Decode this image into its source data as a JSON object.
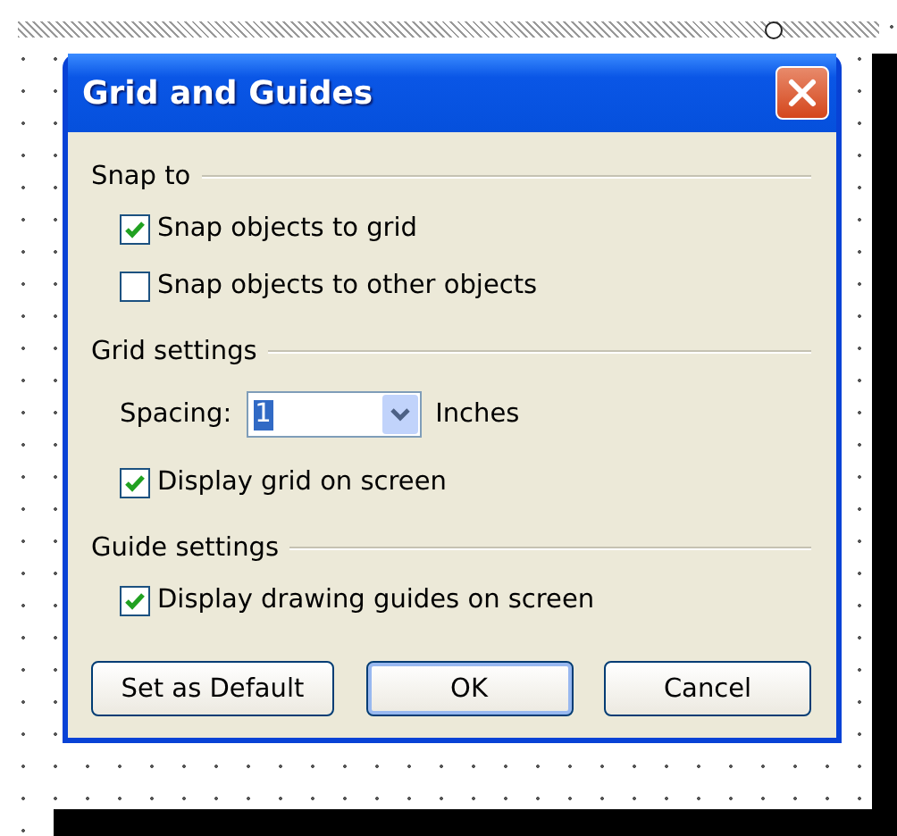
{
  "window": {
    "title": "Grid and Guides"
  },
  "sections": [
    {
      "title": "Snap to",
      "items": [
        {
          "kind": "checkbox",
          "label": "Snap objects to grid",
          "checked": true
        },
        {
          "kind": "checkbox",
          "label": "Snap objects to other objects",
          "checked": false
        }
      ]
    },
    {
      "title": "Grid settings",
      "items": [
        {
          "kind": "dropdown",
          "label": "Spacing:",
          "value": "1",
          "unit": "Inches"
        },
        {
          "kind": "checkbox",
          "label": "Display grid on screen",
          "checked": true
        }
      ]
    },
    {
      "title": "Guide settings",
      "items": [
        {
          "kind": "checkbox",
          "label": "Display drawing guides on screen",
          "checked": true
        }
      ]
    }
  ],
  "buttons": [
    {
      "label": "Set as Default",
      "default": false
    },
    {
      "label": "OK",
      "default": true
    },
    {
      "label": "Cancel",
      "default": false
    }
  ]
}
